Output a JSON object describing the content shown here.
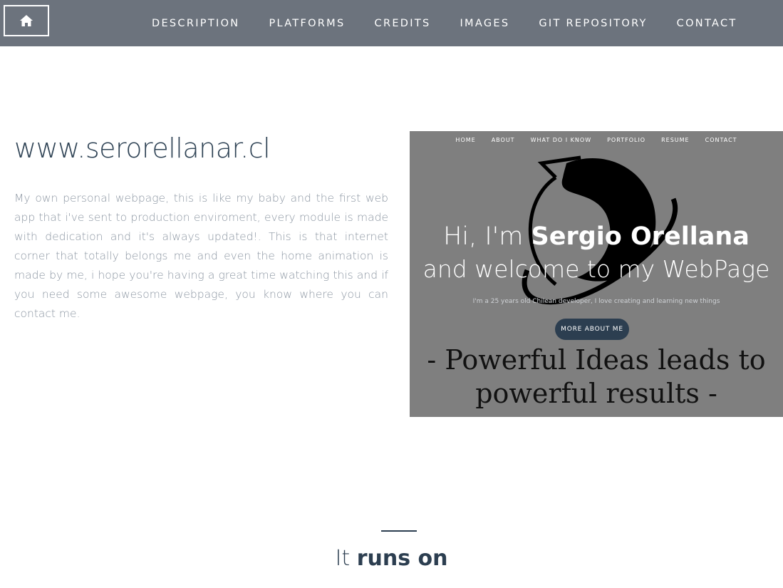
{
  "nav": {
    "home_icon": "home-icon",
    "items": [
      {
        "label": "DESCRIPTION"
      },
      {
        "label": "PLATFORMS"
      },
      {
        "label": "CREDITS"
      },
      {
        "label": "IMAGES"
      },
      {
        "label": "GIT REPOSITORY"
      },
      {
        "label": "CONTACT"
      }
    ]
  },
  "project": {
    "title": "www.serorellanar.cl",
    "description": "My own personal webpage, this is like my baby and the first web app that i've sent to production enviroment, every module is made with dedication and it's always updated!. This is that internet corner that totally belongs me and even the home animation is made by me, i hope you're having a great time watching this and if you need some awesome webpage, you know where you can contact me."
  },
  "preview": {
    "nav": [
      "HOME",
      "ABOUT",
      "WHAT DO I KNOW",
      "PORTFOLIO",
      "RESUME",
      "CONTACT"
    ],
    "greeting_prefix": "Hi, I'm ",
    "greeting_name": "Sergio Orellana",
    "welcome": "and welcome to my WebPage",
    "subtitle": "I'm a 25 years old Chilean developer, I love creating and learning new things",
    "button": "MORE ABOUT ME",
    "motto_line1": "- Powerful Ideas leads to",
    "motto_line2": "powerful results -"
  },
  "section": {
    "prefix": "It ",
    "strong": "runs on"
  },
  "colors": {
    "topbar": "#6c737d",
    "accent": "#2c3e50",
    "preview_bg": "#7f7f7f"
  }
}
